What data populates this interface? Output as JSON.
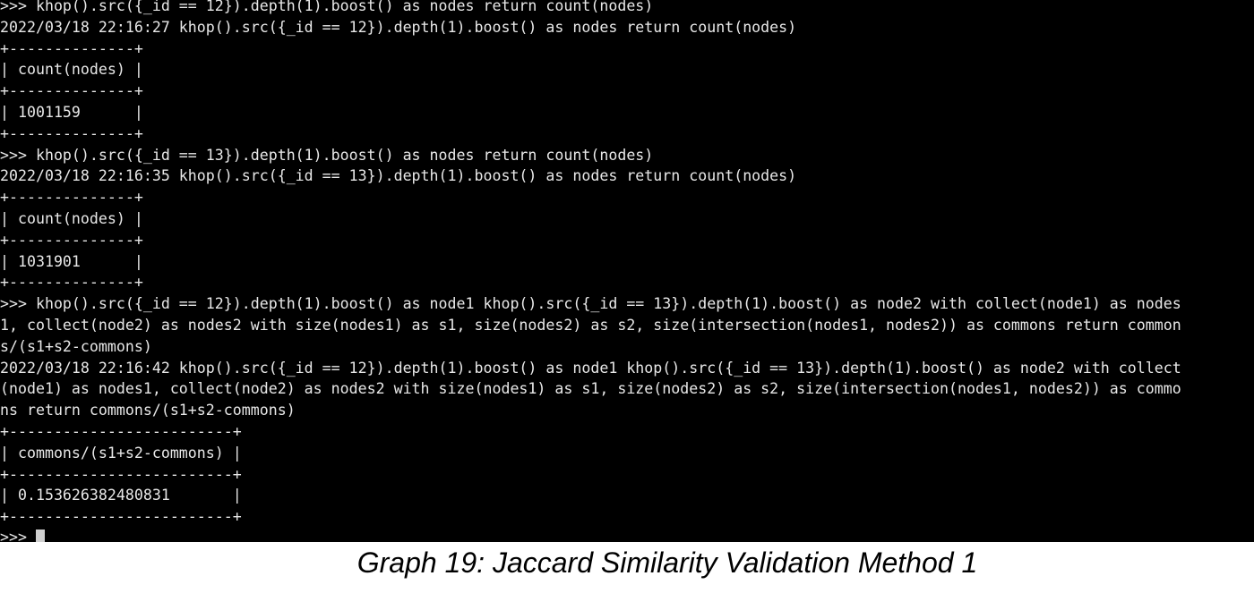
{
  "terminal": {
    "lines": [
      ">>> khop().src({_id == 12}).depth(1).boost() as nodes return count(nodes)",
      "2022/03/18 22:16:27 khop().src({_id == 12}).depth(1).boost() as nodes return count(nodes)",
      "+--------------+",
      "| count(nodes) |",
      "+--------------+",
      "| 1001159      |",
      "+--------------+",
      ">>> khop().src({_id == 13}).depth(1).boost() as nodes return count(nodes)",
      "2022/03/18 22:16:35 khop().src({_id == 13}).depth(1).boost() as nodes return count(nodes)",
      "+--------------+",
      "| count(nodes) |",
      "+--------------+",
      "| 1031901      |",
      "+--------------+",
      ">>> khop().src({_id == 12}).depth(1).boost() as node1 khop().src({_id == 13}).depth(1).boost() as node2 with collect(node1) as nodes",
      "1, collect(node2) as nodes2 with size(nodes1) as s1, size(nodes2) as s2, size(intersection(nodes1, nodes2)) as commons return common",
      "s/(s1+s2-commons)",
      "2022/03/18 22:16:42 khop().src({_id == 12}).depth(1).boost() as node1 khop().src({_id == 13}).depth(1).boost() as node2 with collect",
      "(node1) as nodes1, collect(node2) as nodes2 with size(nodes1) as s1, size(nodes2) as s2, size(intersection(nodes1, nodes2)) as commo",
      "ns return commons/(s1+s2-commons)",
      "+-------------------------+",
      "| commons/(s1+s2-commons) |",
      "+-------------------------+",
      "| 0.153626382480831       |",
      "+-------------------------+"
    ],
    "prompt": ">>> "
  },
  "caption": {
    "text": "Graph 19: Jaccard Similarity Validation Method 1"
  }
}
